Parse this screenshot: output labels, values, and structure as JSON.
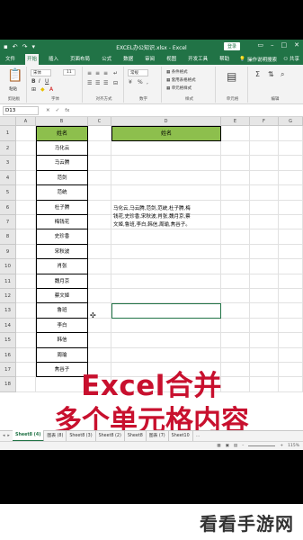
{
  "app": {
    "title": "EXCEL办公知识.xlsx - Excel",
    "login_label": "登录",
    "menu_tabs": [
      "文件",
      "开始",
      "插入",
      "页面布局",
      "公式",
      "数据",
      "审阅",
      "视图",
      "开发工具",
      "帮助"
    ],
    "active_tab": "开始",
    "tell_me": "操作说明搜索",
    "share": "共享"
  },
  "ribbon": {
    "groups": [
      "剪贴板",
      "字体",
      "对齐方式",
      "数字",
      "样式",
      "单元格",
      "编辑"
    ],
    "font_name": "宋体",
    "font_size": "11",
    "number_format": "常规",
    "styles_items": [
      "条件格式",
      "套用表格格式",
      "单元格样式"
    ],
    "paste_label": "粘贴"
  },
  "formula_bar": {
    "name_box": "D13",
    "fx_label": "fx"
  },
  "sheet": {
    "columns": [
      "A",
      "B",
      "C",
      "D",
      "E",
      "F",
      "G"
    ],
    "row_numbers": [
      "1",
      "2",
      "3",
      "4",
      "5",
      "6",
      "7",
      "8",
      "9",
      "10",
      "11",
      "12",
      "13",
      "14",
      "15",
      "16",
      "17",
      "18"
    ],
    "b_header": "姓名",
    "d_header": "姓名",
    "names": [
      "马化云",
      "马云腾",
      "范剑",
      "范统",
      "杜子腾",
      "梅钱花",
      "史珍香",
      "宋秋波",
      "肖张",
      "魏月京",
      "蔡文姬",
      "鲁班",
      "李白",
      "韩信",
      "周瑜",
      "焦谷子"
    ],
    "concat_lines": [
      "马化云,马云腾,范剑,范统,杜子腾,梅",
      "钱花,史珍香,宋秋波,肖张,魏月京,蔡",
      "文姬,鲁班,李白,韩信,周瑜,焦谷子。"
    ]
  },
  "overlay": {
    "line1": "Excel合并",
    "line2": "多个单元格内容"
  },
  "sheet_tabs": [
    "Sheet8 (4)",
    "图表 (8)",
    "Sheet8 (3)",
    "Sheet8 (2)",
    "Sheet8",
    "图表 (7)",
    "Sheet10"
  ],
  "active_sheet": "Sheet8 (4)",
  "status": {
    "zoom": "115%"
  },
  "watermark": "看看手游网",
  "colors": {
    "excel_green": "#217346",
    "header_fill": "#8dbf4d",
    "overlay_red": "#c8102e"
  }
}
